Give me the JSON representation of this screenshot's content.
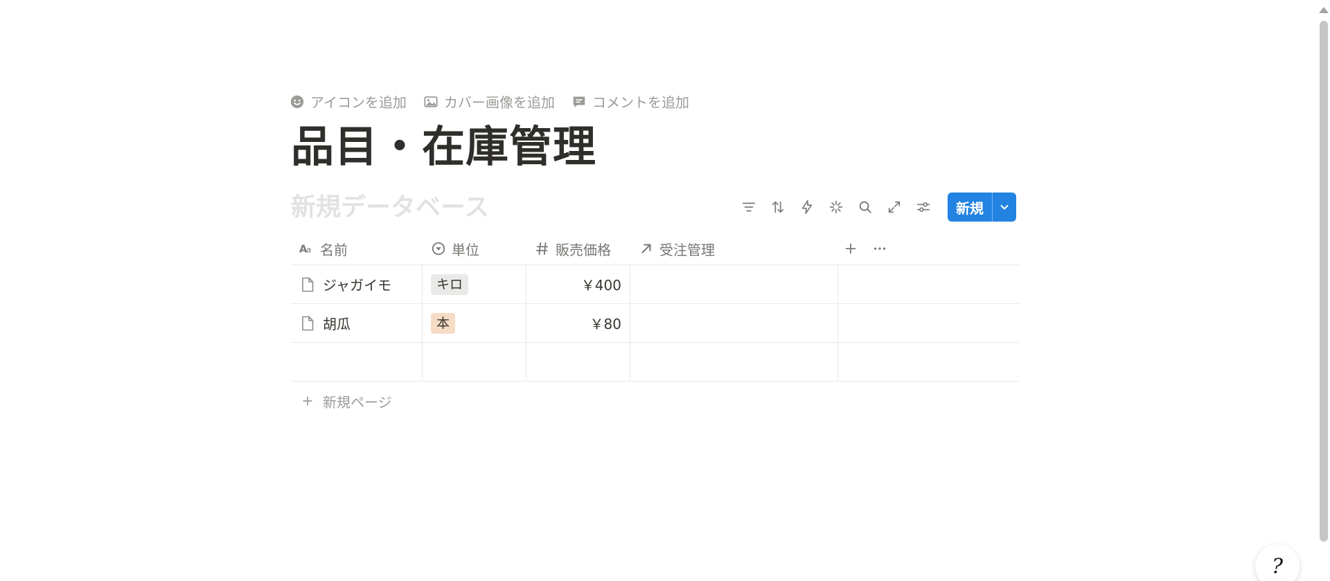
{
  "page_actions": {
    "add_icon": "アイコンを追加",
    "add_cover": "カバー画像を追加",
    "add_comment": "コメントを追加"
  },
  "page": {
    "title": "品目・在庫管理"
  },
  "database": {
    "title": "新規データベース",
    "new_button": "新規",
    "toolbar_icons": [
      "filter-icon",
      "sort-icon",
      "lightning-icon",
      "sparkle-icon",
      "search-icon",
      "expand-icon",
      "settings-sliders-icon"
    ],
    "columns": [
      {
        "key": "name",
        "label": "名前",
        "icon": "text-type-icon"
      },
      {
        "key": "unit",
        "label": "単位",
        "icon": "select-icon"
      },
      {
        "key": "price",
        "label": "販売価格",
        "icon": "number-hash-icon"
      },
      {
        "key": "order",
        "label": "受注管理",
        "icon": "relation-arrow-icon"
      }
    ],
    "rows": [
      {
        "name": "ジャガイモ",
        "unit": "キロ",
        "unit_color": "#e9e9e7",
        "price": "￥400",
        "order": ""
      },
      {
        "name": "胡瓜",
        "unit": "本",
        "unit_color": "#f7dcc5",
        "price": "￥80",
        "order": ""
      }
    ],
    "add_row_label": "新規ページ"
  },
  "help": {
    "label": "?"
  },
  "colors": {
    "accent": "#2383e2",
    "tag_gray": "#e9e9e7",
    "tag_orange": "#f7dcc5"
  }
}
